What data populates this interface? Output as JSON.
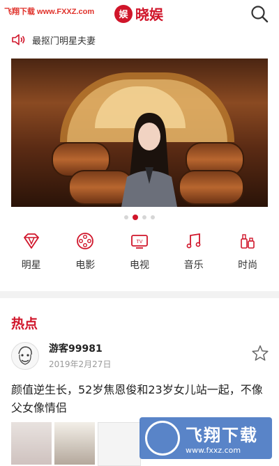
{
  "watermark_top": "飞翔下载 www.FXXZ.com",
  "app": {
    "logo_text": "晓娱",
    "logo_mark": "娱"
  },
  "notice": {
    "text": "最抠门明星夫妻"
  },
  "carousel": {
    "count": 4,
    "active_index": 1
  },
  "categories": [
    {
      "label": "明星",
      "icon": "diamond-icon"
    },
    {
      "label": "电影",
      "icon": "film-reel-icon"
    },
    {
      "label": "电视",
      "icon": "tv-icon"
    },
    {
      "label": "音乐",
      "icon": "music-note-icon"
    },
    {
      "label": "时尚",
      "icon": "perfume-icon"
    }
  ],
  "section": {
    "title": "热点"
  },
  "post": {
    "username": "游客99981",
    "date": "2019年2月27日",
    "text": "颜值逆生长，52岁焦恩俊和23岁女儿站一起，不像父女像情侣"
  },
  "watermark_bottom": {
    "big": "飞翔下载",
    "small": "www.fxxz.com"
  },
  "colors": {
    "accent": "#d0152a",
    "tv_icon": "#d0152a"
  }
}
